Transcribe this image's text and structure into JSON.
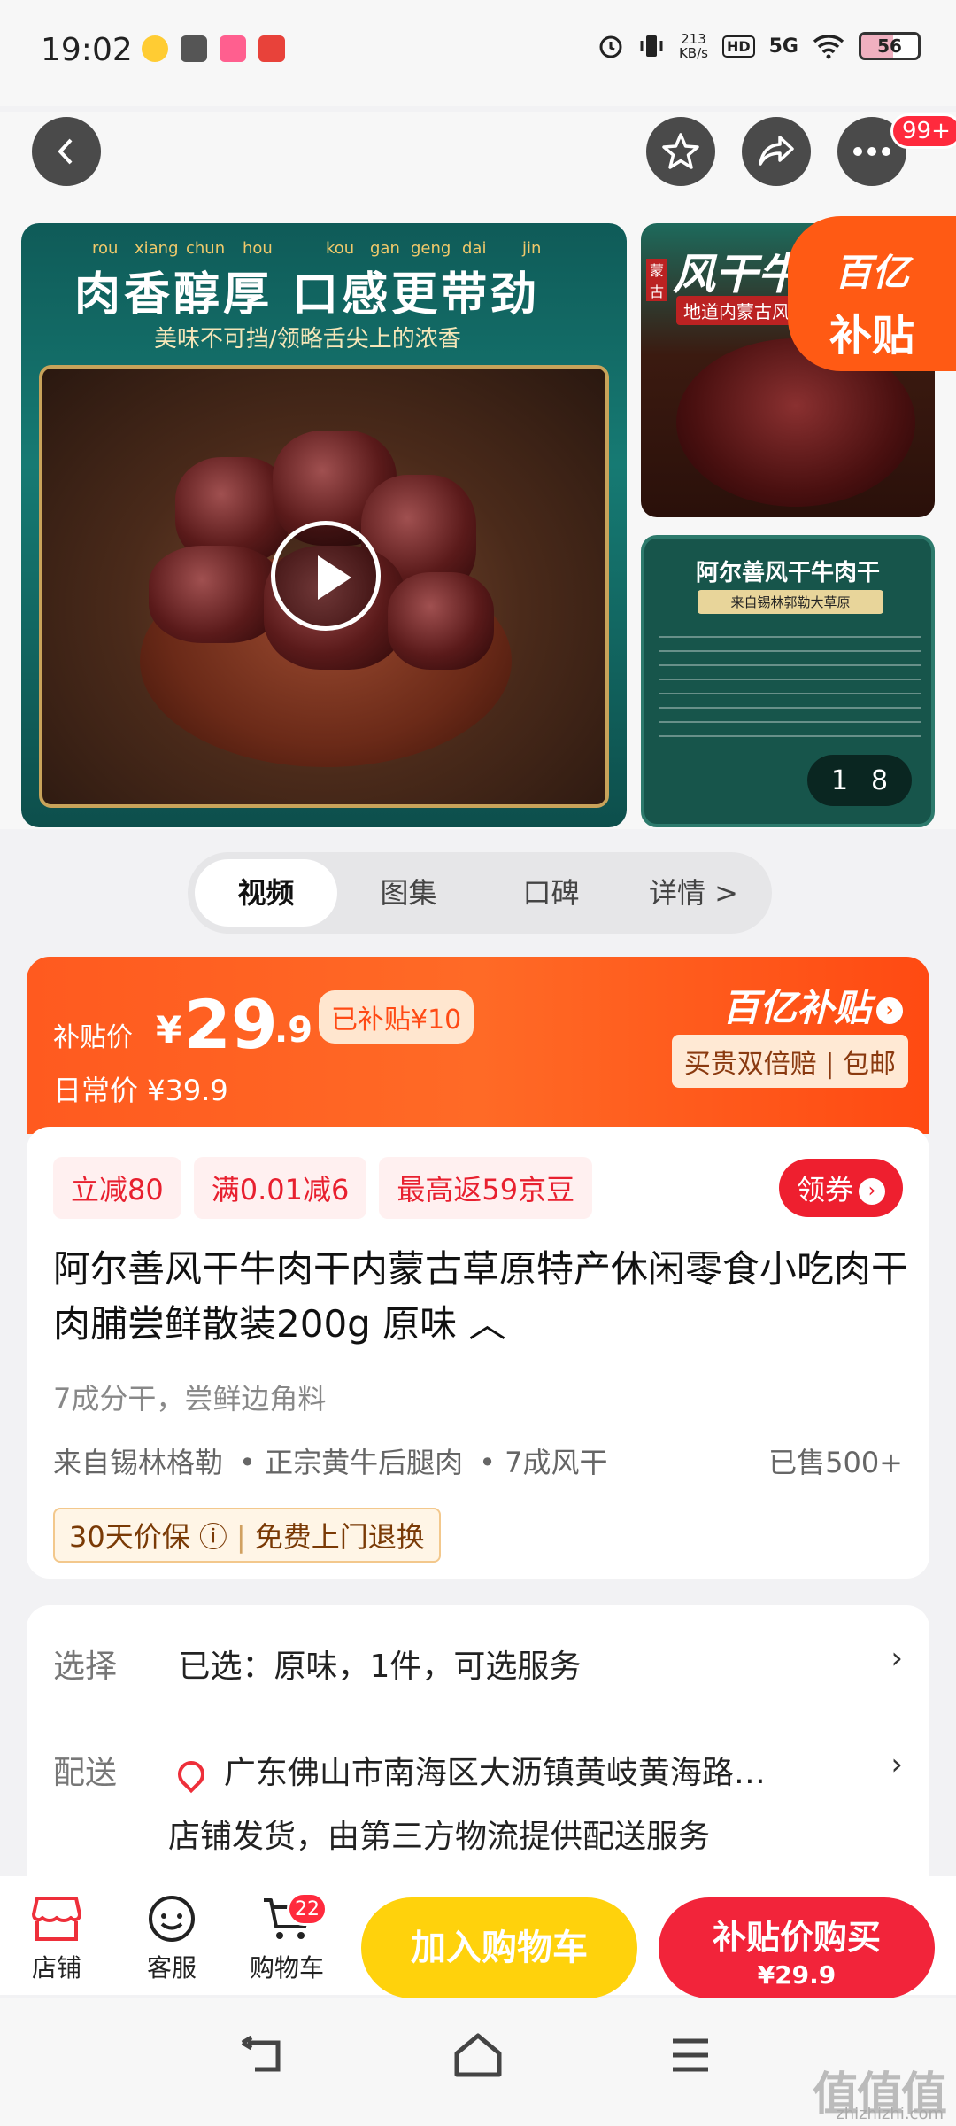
{
  "status_bar": {
    "time": "19:02",
    "net_speed_value": "213",
    "net_speed_unit": "KB/s",
    "hd": "HD",
    "network": "5G",
    "battery": "56"
  },
  "top_nav": {
    "badge": "99+"
  },
  "gallery": {
    "pinyin": [
      "rou",
      "xiang",
      "chun",
      "hou",
      "kou",
      "gan",
      "geng",
      "dai",
      "jin"
    ],
    "main_title": "肉香醇厚 口感更带劲",
    "main_subtitle": "美味不可挡/领略舌尖上的浓香",
    "side1_title": "风干牛肉",
    "side1_tag": "地道内蒙古风",
    "side1_region": "蒙古",
    "subsidy_line1": "百亿",
    "subsidy_line2": "补贴",
    "side2_title": "阿尔善风干牛肉干",
    "side2_subtitle": "来自锡林郭勒大草原",
    "counter_current": "1",
    "counter_total": "8"
  },
  "tabs": [
    {
      "label": "视频",
      "active": true
    },
    {
      "label": "图集",
      "active": false
    },
    {
      "label": "口碑",
      "active": false
    },
    {
      "label": "详情 >",
      "active": false
    }
  ],
  "price": {
    "label": "补贴价",
    "yen": "¥",
    "integer": "29",
    "decimal": ".9",
    "subsidized": "已补贴¥10",
    "daily": "日常价 ¥39.9",
    "brand": "百亿补贴",
    "brand_arrow": "›",
    "benefit": "买贵双倍赔 | 包邮"
  },
  "info": {
    "coupons": [
      "立减80",
      "满0.01减6",
      "最高返59京豆"
    ],
    "get_coupon": "领券",
    "title": "阿尔善风干牛肉干内蒙古草原特产休闲零食小吃肉干肉脯尝鲜散装200g 原味 ︿",
    "subtitle": "7成分干，尝鲜边角料",
    "tags": [
      "来自锡林格勒",
      "• 正宗黄牛后腿肉",
      "• 7成风干"
    ],
    "sold": "已售500+",
    "guarantee_1": "30天价保 ⓘ",
    "guarantee_sep": "|",
    "guarantee_2": "免费上门退换"
  },
  "select": {
    "choose_label": "选择",
    "choose_value": "已选：原味，1件，可选服务",
    "ship_label": "配送",
    "address": "广东佛山市南海区大沥镇黄岐黄海路…",
    "ship_note": "店铺发货，由第三方物流提供配送服务",
    "chevron": "›"
  },
  "bottom_bar": {
    "shop": "店铺",
    "service": "客服",
    "cart": "购物车",
    "cart_count": "22",
    "add_cart": "加入购物车",
    "buy_line1": "补贴价购买",
    "buy_line2": "¥29.9"
  },
  "watermark": {
    "text": "值值值",
    "url": "zhizhizhi.com"
  },
  "colors": {
    "accent_red": "#f2243a",
    "accent_orange": "#ff5a1f",
    "accent_yellow": "#ffd20c"
  }
}
